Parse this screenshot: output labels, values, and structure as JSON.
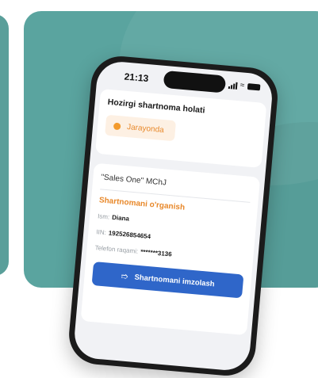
{
  "status_bar": {
    "time": "21:13"
  },
  "current_status_card": {
    "title": "Hozirgi shartnoma holati",
    "status": {
      "label": "Jarayonda",
      "color": "#f39a2c"
    }
  },
  "contract_card": {
    "company": "\"Sales One\" MChJ",
    "review_link": "Shartnomani o'rganish",
    "name_label": "Ism:",
    "name_value": "Diana",
    "inn_label": "IIN:",
    "inn_value": "192526854654",
    "phone_label": "Telefon raqami:",
    "phone_value": "*******3136",
    "sign_button": "Shartnomani imzolash",
    "sign_icon": "signature-icon"
  },
  "colors": {
    "background": "#5aa49f",
    "accent_orange": "#e8882a",
    "button_blue": "#2f66c9"
  }
}
